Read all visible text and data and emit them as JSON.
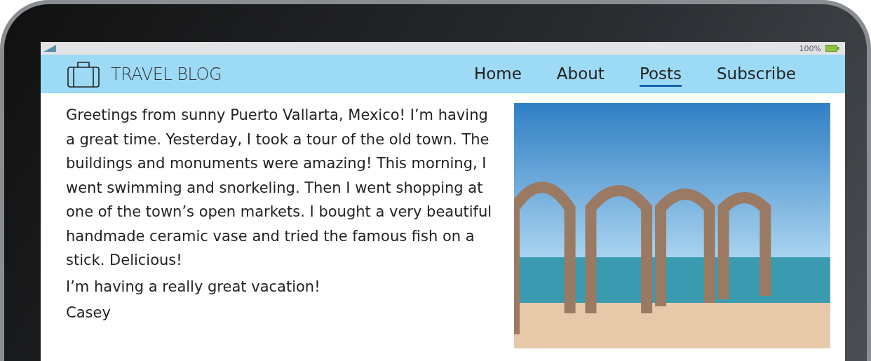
{
  "status_bar": {
    "battery_text": "100%"
  },
  "header": {
    "title": "TRAVEL BLOG"
  },
  "nav": [
    {
      "label": "Home",
      "selected": false
    },
    {
      "label": "About",
      "selected": false
    },
    {
      "label": "Posts",
      "selected": true
    },
    {
      "label": "Subscribe",
      "selected": false
    }
  ],
  "post": {
    "paragraphs": [
      "Greetings from sunny Puerto Vallarta, Mexico! I’m having a great time. Yesterday, I took a tour of the old town. The buildings and monuments were amazing! This morning, I went swimming and snorkeling. Then I went shopping at one of the town’s open markets. I bought a very beautiful handmade ceramic vase and tried the famous fish on a stick. Delicious!",
      "I’m having a really great vacation!",
      "Casey"
    ]
  }
}
